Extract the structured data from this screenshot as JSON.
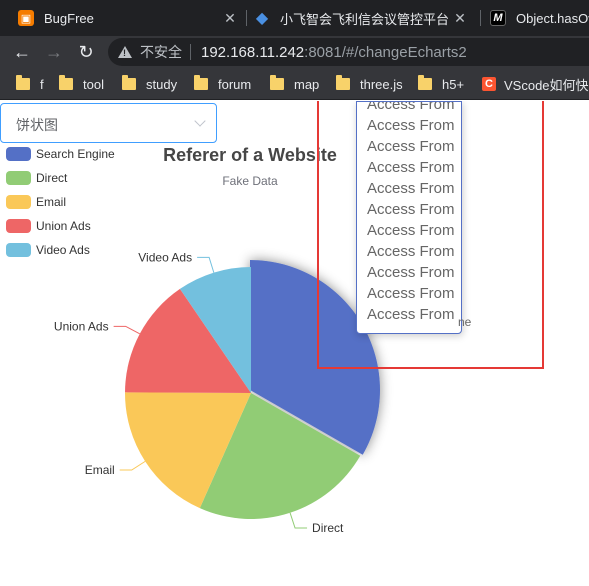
{
  "browser": {
    "tabs": [
      {
        "title": "BugFree",
        "icon": "bugfree-icon",
        "color": "#f57c00"
      },
      {
        "title": "小飞智会飞利信会议管控平台",
        "icon": "app-logo-icon",
        "color": "#2b6fd6"
      },
      {
        "title": "Object.hasOv",
        "icon": "mdn-icon",
        "color": "#000000"
      }
    ],
    "insecure_label": "不安全",
    "url_host": "192.168.11.242",
    "url_path": ":8081/#/changeEcharts2",
    "bookmarks": [
      {
        "label": "f",
        "icon": "folder-icon"
      },
      {
        "label": "tool",
        "icon": "folder-icon"
      },
      {
        "label": "study",
        "icon": "folder-icon"
      },
      {
        "label": "forum",
        "icon": "folder-icon"
      },
      {
        "label": "map",
        "icon": "folder-icon"
      },
      {
        "label": "three.js",
        "icon": "folder-icon"
      },
      {
        "label": "h5+",
        "icon": "folder-icon"
      },
      {
        "label": "VScode如何快速",
        "icon": "csdn-icon"
      }
    ]
  },
  "select": {
    "value": "饼状图"
  },
  "tooltip": {
    "lines": [
      "Access From",
      "Access From",
      "Access From",
      "Access From",
      "Access From",
      "Access From",
      "Access From",
      "Access From",
      "Access From",
      "Access From",
      "Access From"
    ],
    "peek_text": "ne"
  },
  "chart_data": {
    "type": "pie",
    "title": "Referer of a Website",
    "subtitle": "Fake Data",
    "legend_position": "top-left",
    "series": [
      {
        "name": "Search Engine",
        "value": 1048,
        "color": "#5470c6"
      },
      {
        "name": "Direct",
        "value": 735,
        "color": "#91cc75"
      },
      {
        "name": "Email",
        "value": 580,
        "color": "#fac858"
      },
      {
        "name": "Union Ads",
        "value": 484,
        "color": "#ee6666"
      },
      {
        "name": "Video Ads",
        "value": 300,
        "color": "#73c0de"
      }
    ],
    "highlighted": "Search Engine"
  }
}
